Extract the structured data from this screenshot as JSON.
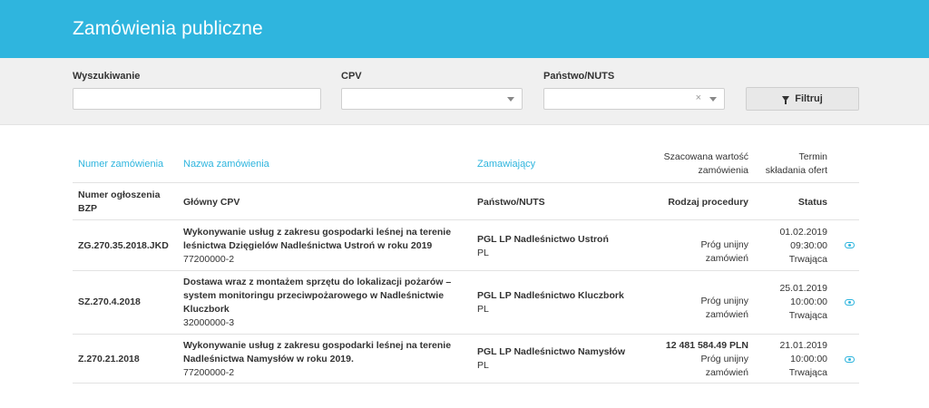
{
  "header": {
    "title": "Zamówienia publiczne"
  },
  "filters": {
    "search_label": "Wyszukiwanie",
    "search_value": "",
    "cpv_label": "CPV",
    "cpv_value": "",
    "nuts_label": "Państwo/NUTS",
    "nuts_value": "",
    "nuts_clear": "×",
    "filter_button": "Filtruj"
  },
  "table": {
    "headers_top": {
      "number": "Numer zamówienia",
      "name": "Nazwa zamówienia",
      "buyer": "Zamawiający",
      "value_line1": "Szacowana wartość",
      "value_line2": "zamówienia",
      "deadline_line1": "Termin",
      "deadline_line2": "składania ofert"
    },
    "headers_sub": {
      "bzp_line1": "Numer ogłoszenia",
      "bzp_line2": "BZP",
      "cpv": "Główny CPV",
      "nuts": "Państwo/NUTS",
      "procedure": "Rodzaj procedury",
      "status": "Status"
    },
    "rows": [
      {
        "number": "ZG.270.35.2018.JKD",
        "name_lines": [
          "Wykonywanie usług z zakresu gospodarki leśnej na terenie",
          "leśnictwa Dzięgielów Nadleśnictwa Ustroń w roku 2019"
        ],
        "cpv": "77200000-2",
        "buyer": "PGL LP Nadleśnictwo Ustroń",
        "country": "PL",
        "value": "",
        "procedure_lines": [
          "Próg unijny",
          "zamówień"
        ],
        "date": "01.02.2019",
        "time": "09:30:00",
        "status": "Trwająca"
      },
      {
        "number": "SZ.270.4.2018",
        "name_lines": [
          "Dostawa wraz z montażem sprzętu do lokalizacji pożarów –",
          "system monitoringu przeciwpożarowego w Nadleśnictwie",
          "Kluczbork"
        ],
        "cpv": "32000000-3",
        "buyer": "PGL LP Nadleśnictwo Kluczbork",
        "country": "PL",
        "value": "",
        "procedure_lines": [
          "Próg unijny",
          "zamówień"
        ],
        "date": "25.01.2019",
        "time": "10:00:00",
        "status": "Trwająca"
      },
      {
        "number": "Z.270.21.2018",
        "name_lines": [
          "Wykonywanie usług z zakresu gospodarki leśnej na terenie",
          "Nadleśnictwa Namysłów w roku 2019."
        ],
        "cpv": "77200000-2",
        "buyer": "PGL LP Nadleśnictwo Namysłów",
        "country": "PL",
        "value": "12 481 584.49 PLN",
        "procedure_lines": [
          "Próg unijny",
          "zamówień"
        ],
        "date": "21.01.2019",
        "time": "10:00:00",
        "status": "Trwająca"
      }
    ]
  },
  "icons": {
    "view": "eye-icon",
    "filter": "funnel-icon",
    "dropdown": "caret-down-icon"
  },
  "colors": {
    "accent": "#2fb5de",
    "header_bg": "#2fb5de",
    "filter_bg": "#f0f0f0"
  }
}
